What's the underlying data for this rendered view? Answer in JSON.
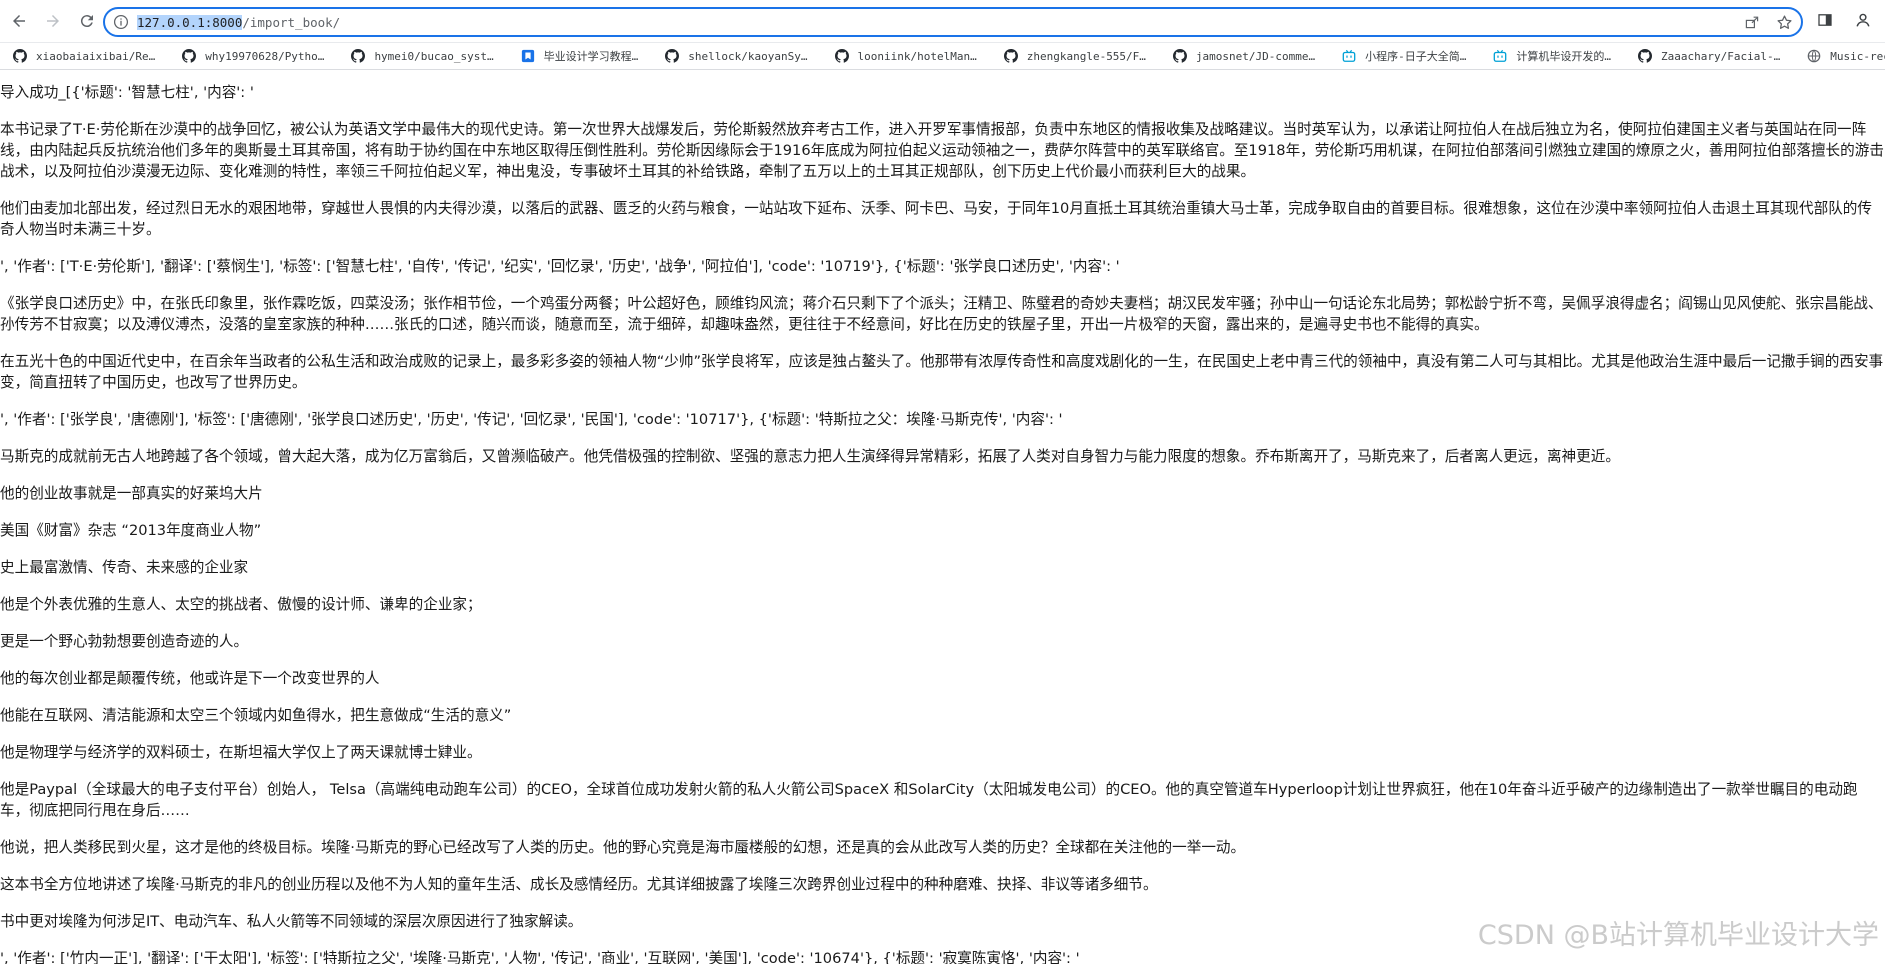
{
  "browser": {
    "url_host": "127.0.0.1:8000",
    "url_path": "/import_book/",
    "bookmarks": [
      {
        "label": "xiaobaiaixibai/Re…",
        "icon": "github-icon"
      },
      {
        "label": "why19970628/Pytho…",
        "icon": "github-icon"
      },
      {
        "label": "hymei0/bucao_syst…",
        "icon": "github-icon"
      },
      {
        "label": "毕业设计学习教程…",
        "icon": "bookmark-icon"
      },
      {
        "label": "shellock/kaoyanSy…",
        "icon": "github-icon"
      },
      {
        "label": "looniink/hotelMan…",
        "icon": "github-icon"
      },
      {
        "label": "zhengkangle-555/F…",
        "icon": "github-icon"
      },
      {
        "label": "jamosnet/JD-comme…",
        "icon": "github-icon"
      },
      {
        "label": "小程序-日子大全简…",
        "icon": "bilibili-icon"
      },
      {
        "label": "计算机毕设开发的…",
        "icon": "bilibili-icon"
      },
      {
        "label": "Zaaachary/Facial-…",
        "icon": "github-icon"
      },
      {
        "label": "Music-recommendat…",
        "icon": "web-icon"
      }
    ]
  },
  "content": {
    "lines": [
      "导入成功_[{'标题': '智慧七柱', '内容': '",
      "本书记录了T·E·劳伦斯在沙漠中的战争回忆，被公认为英语文学中最伟大的现代史诗。第一次世界大战爆发后，劳伦斯毅然放弃考古工作，进入开罗军事情报部，负责中东地区的情报收集及战略建议。当时英军认为，以承诺让阿拉伯人在战后独立为名，使阿拉伯建国主义者与英国站在同一阵线，由内陆起兵反抗统治他们多年的奥斯曼土耳其帝国，将有助于协约国在中东地区取得压倒性胜利。劳伦斯因缘际会于1916年底成为阿拉伯起义运动领袖之一，费萨尔阵营中的英军联络官。至1918年，劳伦斯巧用机谋，在阿拉伯部落间引燃独立建国的燎原之火，善用阿拉伯部落擅长的游击战术，以及阿拉伯沙漠漫无边际、变化难测的特性，率领三千阿拉伯起义军，神出鬼没，专事破坏土耳其的补给铁路，牵制了五万以上的土耳其正规部队，创下历史上代价最小而获利巨大的战果。",
      "他们由麦加北部出发，经过烈日无水的艰困地带，穿越世人畏惧的内夫得沙漠，以落后的武器、匮乏的火药与粮食，一站站攻下延布、沃季、阿卡巴、马安，于同年10月直抵土耳其统治重镇大马士革，完成争取自由的首要目标。很难想象，这位在沙漠中率领阿拉伯人击退土耳其现代部队的传奇人物当时未满三十岁。",
      "', '作者': ['T·E·劳伦斯'], '翻译': ['蔡悯生'], '标签': ['智慧七柱', '自传', '传记', '纪实', '回忆录', '历史', '战争', '阿拉伯'], 'code': '10719'}, {'标题': '张学良口述历史', '内容': '",
      "《张学良口述历史》中，在张氏印象里，张作霖吃饭，四菜没汤；张作相节俭，一个鸡蛋分两餐；叶公超好色，顾维钧风流；蒋介石只剩下了个派头；汪精卫、陈璧君的奇妙夫妻档；胡汉民发牢骚；孙中山一句话论东北局势；郭松龄宁折不弯，吴佩孚浪得虚名；阎锡山见风使舵、张宗昌能战、孙传芳不甘寂寞；以及溥仪溥杰，没落的皇室家族的种种……张氏的口述，随兴而谈，随意而至，流于细碎，却趣味盎然，更往往于不经意间，好比在历史的铁屋子里，开出一片极窄的天窗，露出来的，是遍寻史书也不能得的真实。",
      "在五光十色的中国近代史中，在百余年当政者的公私生活和政治成败的记录上，最多彩多姿的领袖人物“少帅”张学良将军，应该是独占鳌头了。他那带有浓厚传奇性和高度戏剧化的一生，在民国史上老中青三代的领袖中，真没有第二人可与其相比。尤其是他政治生涯中最后一记撒手锏的西安事变，简直扭转了中国历史，也改写了世界历史。",
      "', '作者': ['张学良', '唐德刚'], '标签': ['唐德刚', '张学良口述历史', '历史', '传记', '回忆录', '民国'], 'code': '10717'}, {'标题': '特斯拉之父：埃隆·马斯克传', '内容': '",
      "马斯克的成就前无古人地跨越了各个领域，曾大起大落，成为亿万富翁后，又曾濒临破产。他凭借极强的控制欲、坚强的意志力把人生演绎得异常精彩，拓展了人类对自身智力与能力限度的想象。乔布斯离开了，马斯克来了，后者离人更远，离神更近。",
      "他的创业故事就是一部真实的好莱坞大片",
      "美国《财富》杂志 “2013年度商业人物”",
      "史上最富激情、传奇、未来感的企业家",
      "他是个外表优雅的生意人、太空的挑战者、傲慢的设计师、谦卑的企业家；",
      "更是一个野心勃勃想要创造奇迹的人。",
      "他的每次创业都是颠覆传统，他或许是下一个改变世界的人",
      "他能在互联网、清洁能源和太空三个领域内如鱼得水，把生意做成“生活的意义”",
      "他是物理学与经济学的双料硕士，在斯坦福大学仅上了两天课就博士肄业。",
      "他是Paypal（全球最大的电子支付平台）创始人， Telsa（高端纯电动跑车公司）的CEO，全球首位成功发射火箭的私人火箭公司SpaceX 和SolarCity（太阳城发电公司）的CEO。他的真空管道车Hyperloop计划让世界疯狂，他在10年奋斗近乎破产的边缘制造出了一款举世瞩目的电动跑车，彻底把同行甩在身后……",
      "他说，把人类移民到火星，这才是他的终极目标。埃隆·马斯克的野心已经改写了人类的历史。他的野心究竟是海市蜃楼般的幻想，还是真的会从此改写人类的历史？全球都在关注他的一举一动。",
      "这本书全方位地讲述了埃隆·马斯克的非凡的创业历程以及他不为人知的童年生活、成长及感情经历。尤其详细披露了埃隆三次跨界创业过程中的种种磨难、抉择、非议等诸多细节。",
      "书中更对埃隆为何涉足IT、电动汽车、私人火箭等不同领域的深层次原因进行了独家解读。",
      "', '作者': ['竹内一正'], '翻译': ['干太阳'], '标签': ['特斯拉之父', '埃隆·马斯克', '人物', '传记', '商业', '互联网', '美国'], 'code': '10674'}, {'标题': '寂寞陈寅恪', '内容': '"
    ]
  },
  "watermark": "CSDN @B站计算机毕业设计大学"
}
